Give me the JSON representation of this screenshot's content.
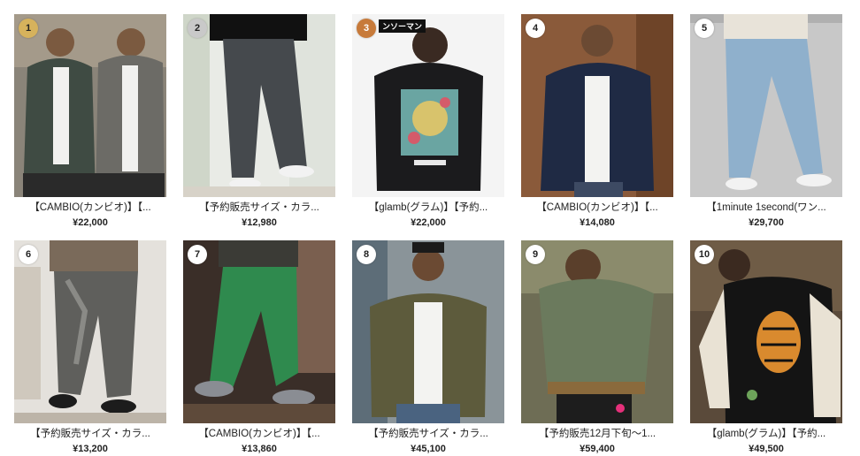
{
  "products": [
    {
      "rank": "1",
      "name": "【CAMBIO(カンビオ)】【...",
      "price": "¥22,000",
      "image": "jacket-gray-hood-icon",
      "badge": "gold"
    },
    {
      "rank": "2",
      "name": "【予約販売サイズ・カラ...",
      "price": "¥12,980",
      "image": "pants-gray-icon",
      "badge": "silver"
    },
    {
      "rank": "3",
      "name": "【glamb(グラム)】【予約...",
      "price": "¥22,000",
      "image": "hoodie-black-print-icon",
      "badge": "bronze",
      "tag": "ンソーマン"
    },
    {
      "rank": "4",
      "name": "【CAMBIO(カンビオ)】【...",
      "price": "¥14,080",
      "image": "jacket-navy-icon",
      "badge": "plain"
    },
    {
      "rank": "5",
      "name": "【1minute 1second(ワン...",
      "price": "¥29,700",
      "image": "jeans-blue-icon",
      "badge": "plain"
    },
    {
      "rank": "6",
      "name": "【予約販売サイズ・カラ...",
      "price": "¥13,200",
      "image": "pants-acid-wash-icon",
      "badge": "plain"
    },
    {
      "rank": "7",
      "name": "【CAMBIO(カンビオ)】【...",
      "price": "¥13,860",
      "image": "pants-green-icon",
      "badge": "plain"
    },
    {
      "rank": "8",
      "name": "【予約販売サイズ・カラ...",
      "price": "¥45,100",
      "image": "jacket-khaki-icon",
      "badge": "plain"
    },
    {
      "rank": "9",
      "name": "【予約販売12月下旬〜1...",
      "price": "¥59,400",
      "image": "jacket-olive-hood-icon",
      "badge": "plain"
    },
    {
      "rank": "10",
      "name": "【glamb(グラム)】【予約...",
      "price": "¥49,500",
      "image": "souvenir-jacket-tiger-icon",
      "badge": "plain"
    }
  ]
}
